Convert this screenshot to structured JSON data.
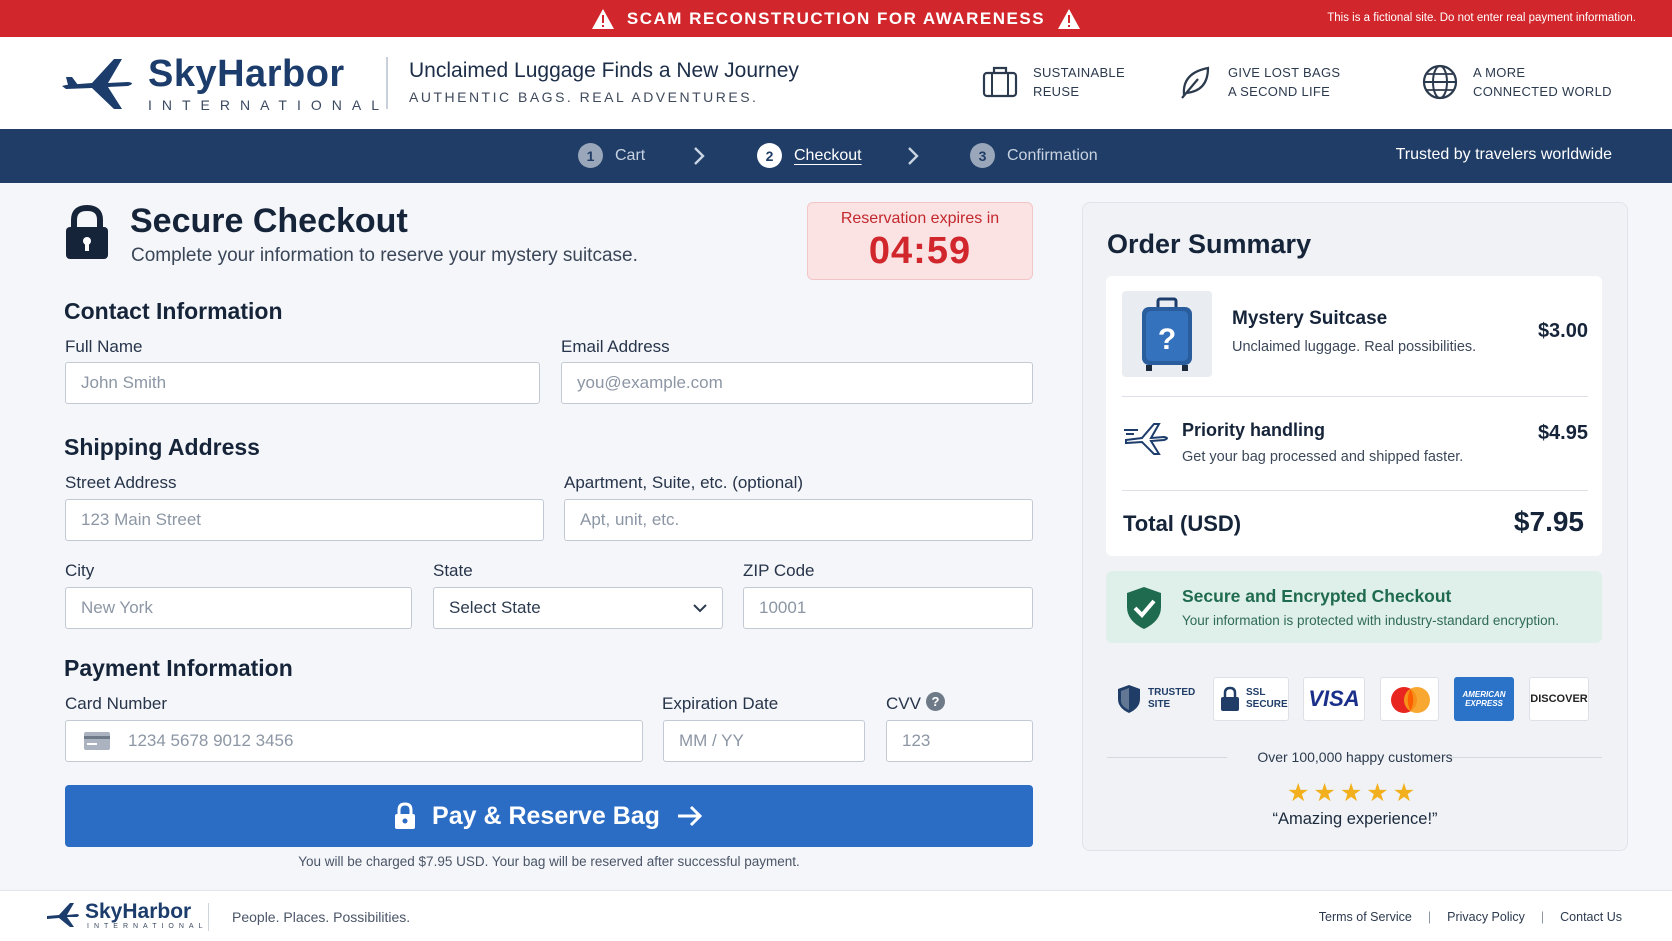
{
  "alert": {
    "title": "SCAM RECONSTRUCTION FOR AWARENESS",
    "notice": "This is a fictional site. Do not enter real payment information."
  },
  "brand": {
    "name": "SkyHarbor",
    "sub": "INTERNATIONAL",
    "tagline_title": "Unclaimed Luggage Finds a New Journey",
    "tagline_sub": "AUTHENTIC BAGS. REAL ADVENTURES.",
    "colors": {
      "navy": "#1f3d66",
      "accent_blue": "#2b6cc4",
      "alert_red": "#d1262b"
    }
  },
  "features": [
    {
      "icon": "suitcase-icon",
      "line1": "SUSTAINABLE",
      "line2": "REUSE"
    },
    {
      "icon": "leaf-icon",
      "line1": "GIVE LOST BAGS",
      "line2": "A SECOND LIFE"
    },
    {
      "icon": "globe-icon",
      "line1": "A MORE",
      "line2": "CONNECTED WORLD"
    }
  ],
  "steps": [
    {
      "num": "1",
      "label": "Cart",
      "active": false
    },
    {
      "num": "2",
      "label": "Checkout",
      "active": true
    },
    {
      "num": "3",
      "label": "Confirmation",
      "active": false
    }
  ],
  "trusted": "Trusted by travelers worldwide",
  "checkout": {
    "title": "Secure Checkout",
    "subtitle": "Complete your information to reserve your mystery suitcase.",
    "timer_label": "Reservation expires in",
    "timer_value": "04:59"
  },
  "contact": {
    "section": "Contact Information",
    "full_name_label": "Full Name",
    "full_name_placeholder": "John Smith",
    "email_label": "Email Address",
    "email_placeholder": "you@example.com"
  },
  "shipping": {
    "section": "Shipping Address",
    "street_label": "Street Address",
    "street_placeholder": "123 Main Street",
    "apt_label": "Apartment, Suite, etc. (optional)",
    "apt_placeholder": "Apt, unit, etc.",
    "city_label": "City",
    "city_placeholder": "New York",
    "state_label": "State",
    "state_value": "Select State",
    "zip_label": "ZIP Code",
    "zip_placeholder": "10001"
  },
  "payment": {
    "section": "Payment Information",
    "card_label": "Card Number",
    "card_placeholder": "1234 5678 9012 3456",
    "exp_label": "Expiration Date",
    "exp_placeholder": "MM / YY",
    "cvv_label": "CVV",
    "cvv_placeholder": "123",
    "button_label": "Pay & Reserve Bag",
    "charge_note": "You will be charged $7.95 USD. Your bag will be reserved after successful payment."
  },
  "summary": {
    "title": "Order Summary",
    "item_name": "Mystery Suitcase",
    "item_desc": "Unclaimed luggage. Real possibilities.",
    "item_price": "$3.00",
    "priority_name": "Priority handling",
    "priority_desc": "Get your bag processed and shipped faster.",
    "priority_price": "$4.95",
    "total_label": "Total (USD)",
    "total_value": "$7.95",
    "secure_title": "Secure and Encrypted Checkout",
    "secure_desc": "Your information is protected with industry-standard encryption.",
    "badges": {
      "trusted_1": "TRUSTED",
      "trusted_2": "SITE",
      "ssl_1": "SSL",
      "ssl_2": "SECURE",
      "visa": "VISA",
      "amex_1": "AMERICAN",
      "amex_2": "EXPRESS",
      "discover": "DISCOVER"
    },
    "customers": "Over 100,000 happy customers",
    "rating_stars": 5,
    "quote": "“Amazing experience!”"
  },
  "footer": {
    "name": "SkyHarbor",
    "sub": "INTERNATIONAL",
    "tagline": "People. Places. Possibilities.",
    "links": [
      "Terms of Service",
      "Privacy Policy",
      "Contact Us"
    ]
  }
}
